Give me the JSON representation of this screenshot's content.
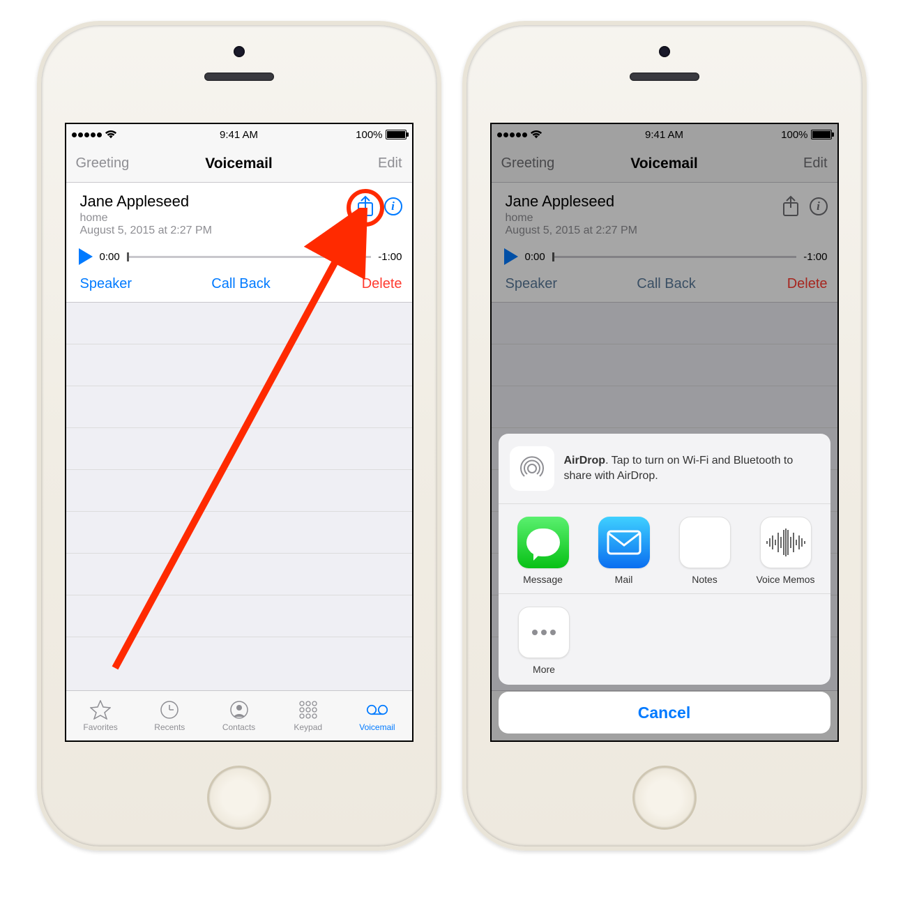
{
  "status": {
    "time": "9:41 AM",
    "battery": "100%"
  },
  "nav": {
    "left": "Greeting",
    "title": "Voicemail",
    "right": "Edit"
  },
  "vm": {
    "name": "Jane Appleseed",
    "label": "home",
    "date": "August 5, 2015 at 2:27 PM",
    "time_current": "0:00",
    "time_remaining": "-1:00",
    "speaker": "Speaker",
    "callback": "Call Back",
    "delete": "Delete"
  },
  "tabs": {
    "favorites": "Favorites",
    "recents": "Recents",
    "contacts": "Contacts",
    "keypad": "Keypad",
    "voicemail": "Voicemail"
  },
  "share": {
    "airdrop_bold": "AirDrop",
    "airdrop_text": ". Tap to turn on Wi-Fi and Bluetooth to share with AirDrop.",
    "apps": {
      "message": "Message",
      "mail": "Mail",
      "notes": "Notes",
      "voicememos": "Voice Memos"
    },
    "more": "More",
    "cancel": "Cancel"
  }
}
